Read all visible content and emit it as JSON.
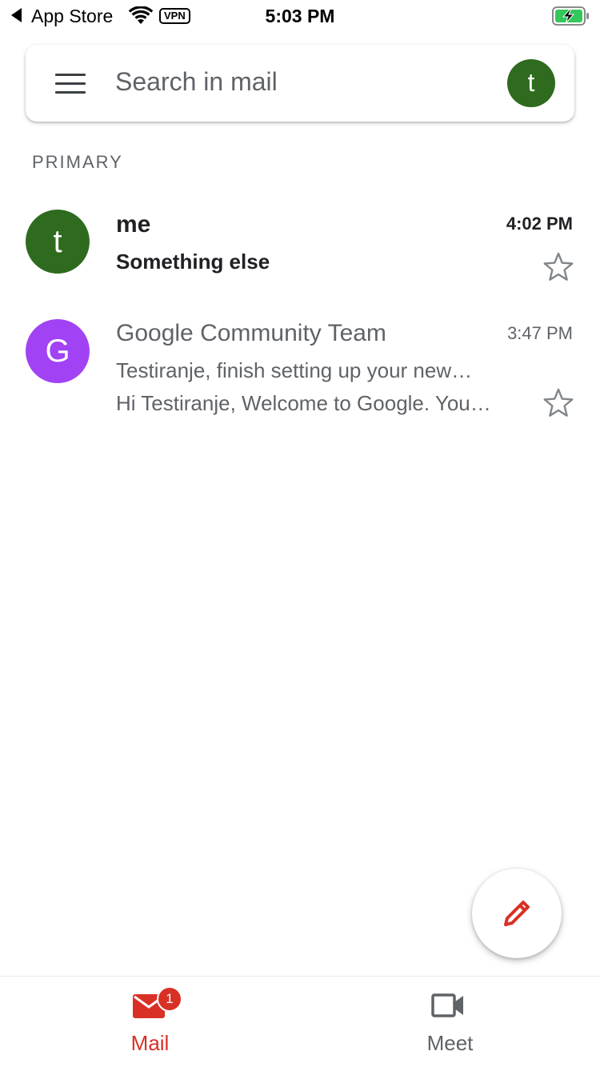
{
  "status_bar": {
    "carrier": "App Store",
    "vpn_label": "VPN",
    "time": "5:03 PM",
    "battery_state": "charging",
    "icons": [
      "back-arrow-icon",
      "wifi-icon",
      "vpn-icon",
      "battery-charging-icon"
    ]
  },
  "search": {
    "placeholder": "Search in mail",
    "account_initial": "t",
    "account_color": "#2e6b1e"
  },
  "section": {
    "label": "PRIMARY"
  },
  "mails": [
    {
      "sender": "me",
      "subject": "Something else",
      "snippet": "",
      "time": "4:02 PM",
      "unread": true,
      "starred": false,
      "avatar_initial": "t",
      "avatar_color": "#2e6b1e"
    },
    {
      "sender": "Google Community Team",
      "subject": "Testiranje, finish setting up your new…",
      "snippet": "Hi Testiranje, Welcome to Google. You…",
      "time": "3:47 PM",
      "unread": false,
      "starred": false,
      "avatar_initial": "G",
      "avatar_color": "#a142f4"
    }
  ],
  "compose": {
    "icon": "pencil-icon",
    "color": "#d93025"
  },
  "bottom_nav": {
    "mail": {
      "label": "Mail",
      "badge": "1",
      "icon": "mail-icon",
      "active": true
    },
    "meet": {
      "label": "Meet",
      "icon": "video-camera-icon",
      "active": false
    },
    "active_color": "#d93025",
    "inactive_color": "#5f6368"
  }
}
